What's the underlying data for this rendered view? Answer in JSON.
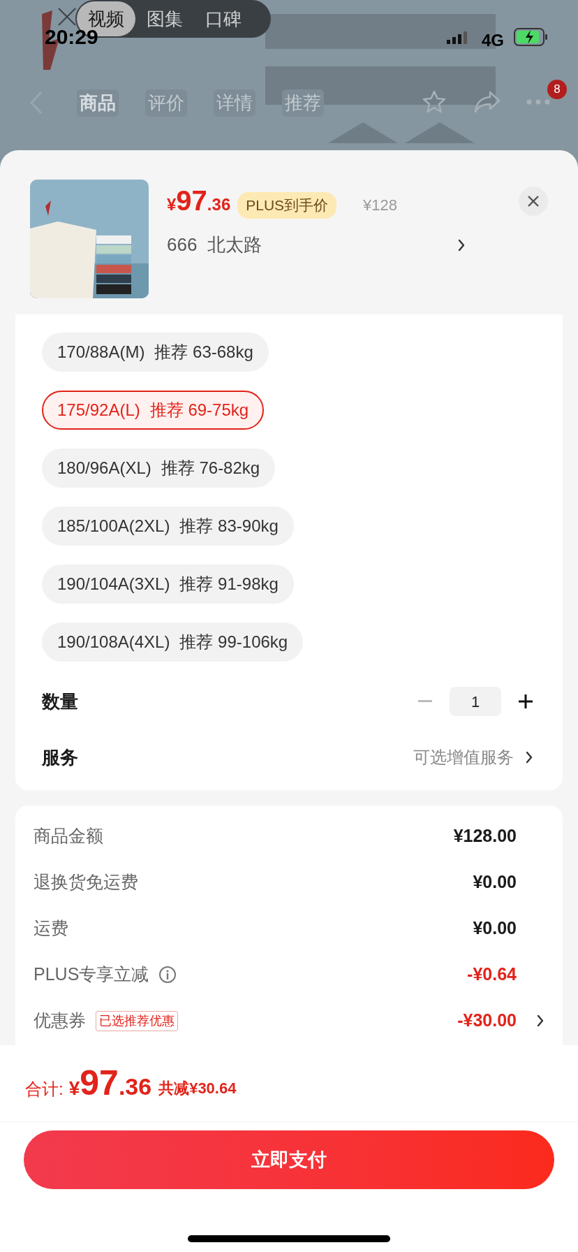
{
  "status_bar": {
    "time": "20:29",
    "network": "4G"
  },
  "media_tabs": [
    {
      "label": "视频",
      "selected": true
    },
    {
      "label": "图集",
      "selected": false
    },
    {
      "label": "口碑",
      "selected": false
    }
  ],
  "nav_tabs": [
    {
      "label": "商品",
      "selected": true
    },
    {
      "label": "评价",
      "selected": false
    },
    {
      "label": "详情",
      "selected": false
    },
    {
      "label": "推荐",
      "selected": false
    }
  ],
  "more_badge": "8",
  "product": {
    "currency": "¥",
    "price_int": "97",
    "price_dec": ".36",
    "plus_tag": "PLUS到手价",
    "original_price": "¥128",
    "spec": "666  北太路"
  },
  "sizes": [
    {
      "label": "170/88A(M)",
      "note": "推荐 63-68kg",
      "selected": false
    },
    {
      "label": "175/92A(L)",
      "note": "推荐 69-75kg",
      "selected": true
    },
    {
      "label": "180/96A(XL)",
      "note": "推荐 76-82kg",
      "selected": false
    },
    {
      "label": "185/100A(2XL)",
      "note": "推荐 83-90kg",
      "selected": false
    },
    {
      "label": "190/104A(3XL)",
      "note": "推荐 91-98kg",
      "selected": false
    },
    {
      "label": "190/108A(4XL)",
      "note": "推荐 99-106kg",
      "selected": false
    }
  ],
  "quantity": {
    "label": "数量",
    "value": "1",
    "minus_disabled": true
  },
  "service": {
    "label": "服务",
    "value": "可选增值服务"
  },
  "fees": [
    {
      "label": "商品金额",
      "value": "¥128.00",
      "negative": false,
      "info": false,
      "link": false
    },
    {
      "label": "退换货免运费",
      "value": "¥0.00",
      "negative": false,
      "info": false,
      "link": false
    },
    {
      "label": "运费",
      "value": "¥0.00",
      "negative": false,
      "info": false,
      "link": false
    },
    {
      "label": "PLUS专享立减",
      "value": "-¥0.64",
      "negative": true,
      "info": true,
      "link": false
    },
    {
      "label": "优惠券",
      "tag": "已选推荐优惠",
      "value": "-¥30.00",
      "negative": true,
      "info": false,
      "link": true
    }
  ],
  "total": {
    "label": "合计:",
    "currency": "¥",
    "int": "97",
    "dec": ".36",
    "saved": "共减¥30.64"
  },
  "pay_button": "立即支付"
}
